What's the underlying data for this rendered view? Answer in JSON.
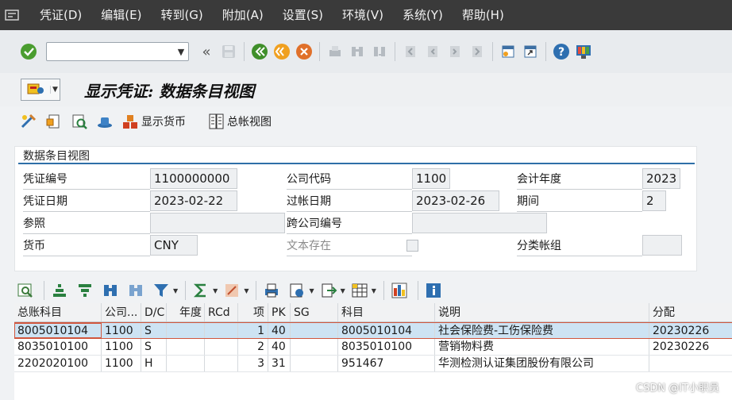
{
  "menu": [
    "凭证(D)",
    "编辑(E)",
    "转到(G)",
    "附加(A)",
    "设置(S)",
    "环境(V)",
    "系统(Y)",
    "帮助(H)"
  ],
  "command_field": {
    "value": ""
  },
  "page_title": "显示凭证: 数据条目视图",
  "app_toolbar": {
    "display_currency": "显示货币",
    "ledger_view": "总帐视图"
  },
  "header": {
    "section_title": "数据条目视图",
    "labels": {
      "doc_number": "凭证编号",
      "company_code": "公司代码",
      "fiscal_year": "会计年度",
      "doc_date": "凭证日期",
      "posting_date": "过帐日期",
      "period": "期间",
      "reference": "参照",
      "cross_company": "跨公司编号",
      "currency": "货币",
      "text_exists": "文本存在",
      "ledger_group": "分类帐组"
    },
    "values": {
      "doc_number": "1100000000",
      "company_code": "1100",
      "fiscal_year": "2023",
      "doc_date": "2023-02-22",
      "posting_date": "2023-02-26",
      "period": "2",
      "reference": "",
      "cross_company": "",
      "currency": "CNY",
      "ledger_group": "",
      "text_exists": false
    }
  },
  "grid": {
    "columns": [
      "总账科目",
      "公司...",
      "D/C",
      "年度",
      "RCd",
      "项",
      "PK",
      "SG",
      "科目",
      "说明",
      "分配"
    ],
    "rows": [
      [
        "8005010104",
        "1100",
        "S",
        "",
        "",
        "1",
        "40",
        "",
        "8005010104",
        "社会保险费-工伤保险费",
        "20230226"
      ],
      [
        "8035010100",
        "1100",
        "S",
        "",
        "",
        "2",
        "40",
        "",
        "8035010100",
        "营销物料费",
        "20230226"
      ],
      [
        "2202020100",
        "1100",
        "H",
        "",
        "",
        "3",
        "31",
        "",
        "951467",
        "华测检测认证集团股份有限公司",
        ""
      ]
    ]
  },
  "watermark": "CSDN @IT小职员",
  "colors": {
    "menubar": "#3a3a3a",
    "selected_row": "#cde3f3",
    "accent_rule": "#2e6fa8",
    "focus": "#d0563d"
  }
}
